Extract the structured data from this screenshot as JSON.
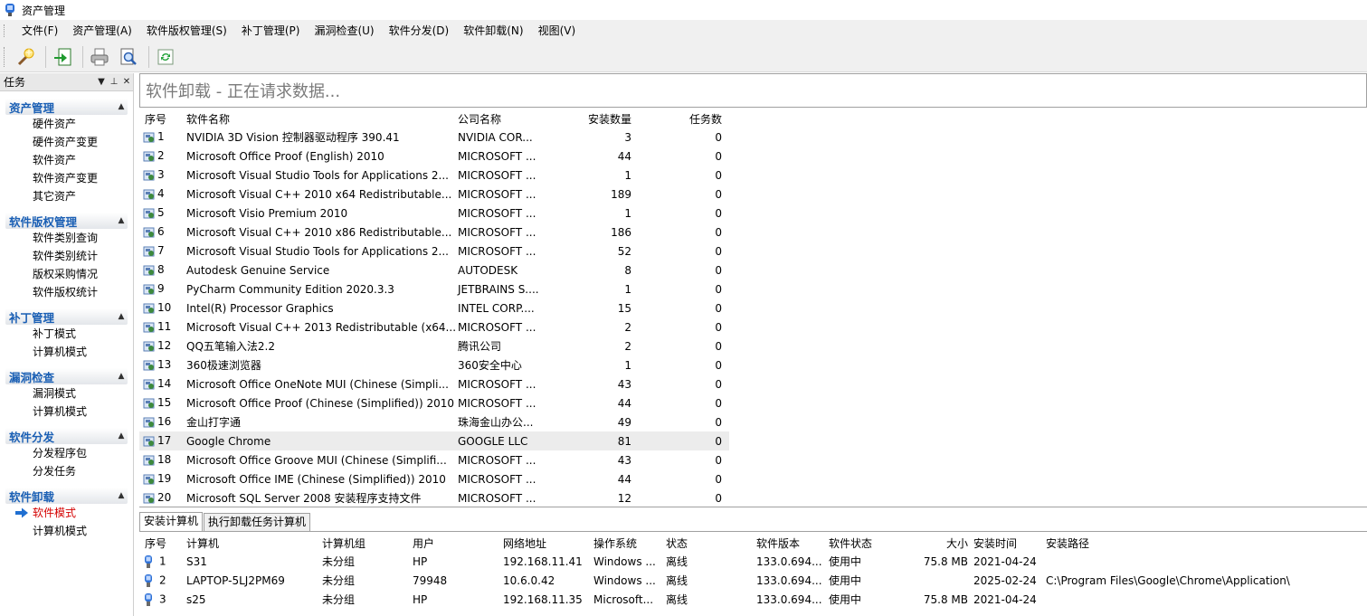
{
  "window": {
    "title": "资产管理"
  },
  "menu": [
    {
      "label": "文件(F)"
    },
    {
      "label": "资产管理(A)"
    },
    {
      "label": "软件版权管理(S)"
    },
    {
      "label": "补丁管理(P)"
    },
    {
      "label": "漏洞检查(U)"
    },
    {
      "label": "软件分发(D)"
    },
    {
      "label": "软件卸载(N)"
    },
    {
      "label": "视图(V)"
    }
  ],
  "toolbar": {
    "icons": [
      "search-wand-icon",
      "export-icon",
      "print-icon",
      "print-preview-icon",
      "refresh-icon"
    ]
  },
  "taskpanel": {
    "title": "任务",
    "groups": [
      {
        "title": "资产管理",
        "items": [
          "硬件资产",
          "硬件资产变更",
          "软件资产",
          "软件资产变更",
          "其它资产"
        ]
      },
      {
        "title": "软件版权管理",
        "items": [
          "软件类别查询",
          "软件类别统计",
          "版权采购情况",
          "软件版权统计"
        ]
      },
      {
        "title": "补丁管理",
        "items": [
          "补丁模式",
          "计算机模式"
        ]
      },
      {
        "title": "漏洞检查",
        "items": [
          "漏洞模式",
          "计算机模式"
        ]
      },
      {
        "title": "软件分发",
        "items": [
          "分发程序包",
          "分发任务"
        ]
      },
      {
        "title": "软件卸载",
        "items": [
          "软件模式",
          "计算机模式"
        ],
        "active_index": 0
      }
    ]
  },
  "main": {
    "title": "软件卸载 - 正在请求数据...",
    "software_table": {
      "columns": [
        "序号",
        "软件名称",
        "公司名称",
        "安装数量",
        "任务数"
      ],
      "selected_index": 16,
      "rows": [
        [
          "1",
          "NVIDIA 3D Vision 控制器驱动程序 390.41",
          "NVIDIA COR...",
          "3",
          "0"
        ],
        [
          "2",
          "Microsoft Office Proof (English) 2010",
          "MICROSOFT ...",
          "44",
          "0"
        ],
        [
          "3",
          "Microsoft Visual Studio Tools for Applications 2...",
          "MICROSOFT ...",
          "1",
          "0"
        ],
        [
          "4",
          "Microsoft Visual C++ 2010  x64 Redistributable...",
          "MICROSOFT ...",
          "189",
          "0"
        ],
        [
          "5",
          "Microsoft Visio Premium 2010",
          "MICROSOFT ...",
          "1",
          "0"
        ],
        [
          "6",
          "Microsoft Visual C++ 2010  x86 Redistributable...",
          "MICROSOFT ...",
          "186",
          "0"
        ],
        [
          "7",
          "Microsoft Visual Studio Tools for Applications 2...",
          "MICROSOFT ...",
          "52",
          "0"
        ],
        [
          "8",
          "Autodesk Genuine Service",
          "AUTODESK",
          "8",
          "0"
        ],
        [
          "9",
          "PyCharm Community Edition 2020.3.3",
          "JETBRAINS S....",
          "1",
          "0"
        ],
        [
          "10",
          "Intel(R) Processor Graphics",
          "INTEL CORP....",
          "15",
          "0"
        ],
        [
          "11",
          "Microsoft Visual C++ 2013 Redistributable (x64...",
          "MICROSOFT ...",
          "2",
          "0"
        ],
        [
          "12",
          "QQ五笔输入法2.2",
          "腾讯公司",
          "2",
          "0"
        ],
        [
          "13",
          "360极速浏览器",
          "360安全中心",
          "1",
          "0"
        ],
        [
          "14",
          "Microsoft Office OneNote MUI (Chinese (Simpli...",
          "MICROSOFT ...",
          "43",
          "0"
        ],
        [
          "15",
          "Microsoft Office Proof (Chinese (Simplified)) 2010",
          "MICROSOFT ...",
          "44",
          "0"
        ],
        [
          "16",
          "金山打字通",
          "珠海金山办公...",
          "49",
          "0"
        ],
        [
          "17",
          "Google Chrome",
          "GOOGLE LLC",
          "81",
          "0"
        ],
        [
          "18",
          "Microsoft Office Groove MUI (Chinese (Simplifi...",
          "MICROSOFT ...",
          "43",
          "0"
        ],
        [
          "19",
          "Microsoft Office IME (Chinese (Simplified)) 2010",
          "MICROSOFT ...",
          "44",
          "0"
        ],
        [
          "20",
          "Microsoft SQL Server 2008 安装程序支持文件",
          "MICROSOFT ...",
          "12",
          "0"
        ]
      ]
    },
    "tabs": [
      {
        "label": "安装计算机",
        "active": true
      },
      {
        "label": "执行卸载任务计算机",
        "active": false
      }
    ],
    "computer_table": {
      "columns": [
        "序号",
        "计算机",
        "计算机组",
        "用户",
        "网络地址",
        "操作系统",
        "状态",
        "软件版本",
        "软件状态",
        "大小",
        "安装时间",
        "安装路径"
      ],
      "rows": [
        [
          "1",
          "S31",
          "未分组",
          "HP",
          "192.168.11.41",
          "Windows ...",
          "离线",
          "133.0.694...",
          "使用中",
          "75.8 MB",
          "2021-04-24",
          ""
        ],
        [
          "2",
          "LAPTOP-5LJ2PM69",
          "未分组",
          "79948",
          "10.6.0.42",
          "Windows ...",
          "离线",
          "133.0.694...",
          "使用中",
          "",
          "2025-02-24",
          "C:\\Program Files\\Google\\Chrome\\Application\\"
        ],
        [
          "3",
          "s25",
          "未分组",
          "HP",
          "192.168.11.35",
          "Microsoft...",
          "离线",
          "133.0.694...",
          "使用中",
          "75.8 MB",
          "2021-04-24",
          ""
        ]
      ]
    }
  }
}
